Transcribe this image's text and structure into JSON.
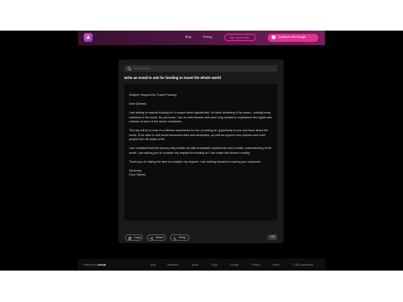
{
  "header": {
    "logo_icon": "rocket-icon",
    "nav": {
      "blog": "Blog",
      "pricing": "Pricing"
    },
    "signup_label": "Sign up free with...",
    "continue_label": "Continue with Google",
    "brand_color": "#e0338f"
  },
  "composer": {
    "search_placeholder": "Search here",
    "prompt": "write an email to ask for funding to travel the whole world",
    "output": [
      "Subject: Request for Travel Funding",
      "Dear [Name],",
      "I am writing to request funding for a unique travel opportunity I've been dreaming of for years—visiting every continent in the world. As you know, I am an avid traveler and have long wanted to experience the sights and cultures of each of the seven continents.",
      "This trip will be a once-in-a-lifetime experience for me, providing an opportunity to see and learn about the world. I'll be able to visit world-renowned sites and landmarks, as well as explore new cultures and meet people from all walks of life.",
      "I am confident that this journey will provide me with invaluable experiences and a better understanding of the world. I am asking you to consider my request for funding so I can make this dream a reality.",
      "Thank you for taking the time to consider my request. I am looking forward to hearing your response.",
      "Sincerely,\n[Your Name]"
    ],
    "actions": {
      "copy": "Copy",
      "share": "Share",
      "retry": "Retry"
    },
    "count_badge": "148"
  },
  "footer": {
    "powered_prefix": "Powered by",
    "powered_brand": "ordinal",
    "links": {
      "blog": "Blog",
      "templates": "Templates",
      "about": "About",
      "faqs": "FAQs",
      "contact": "Contact",
      "privacy": "Privacy",
      "terms": "Terms"
    },
    "copyright": "© 2023 writesonic"
  }
}
